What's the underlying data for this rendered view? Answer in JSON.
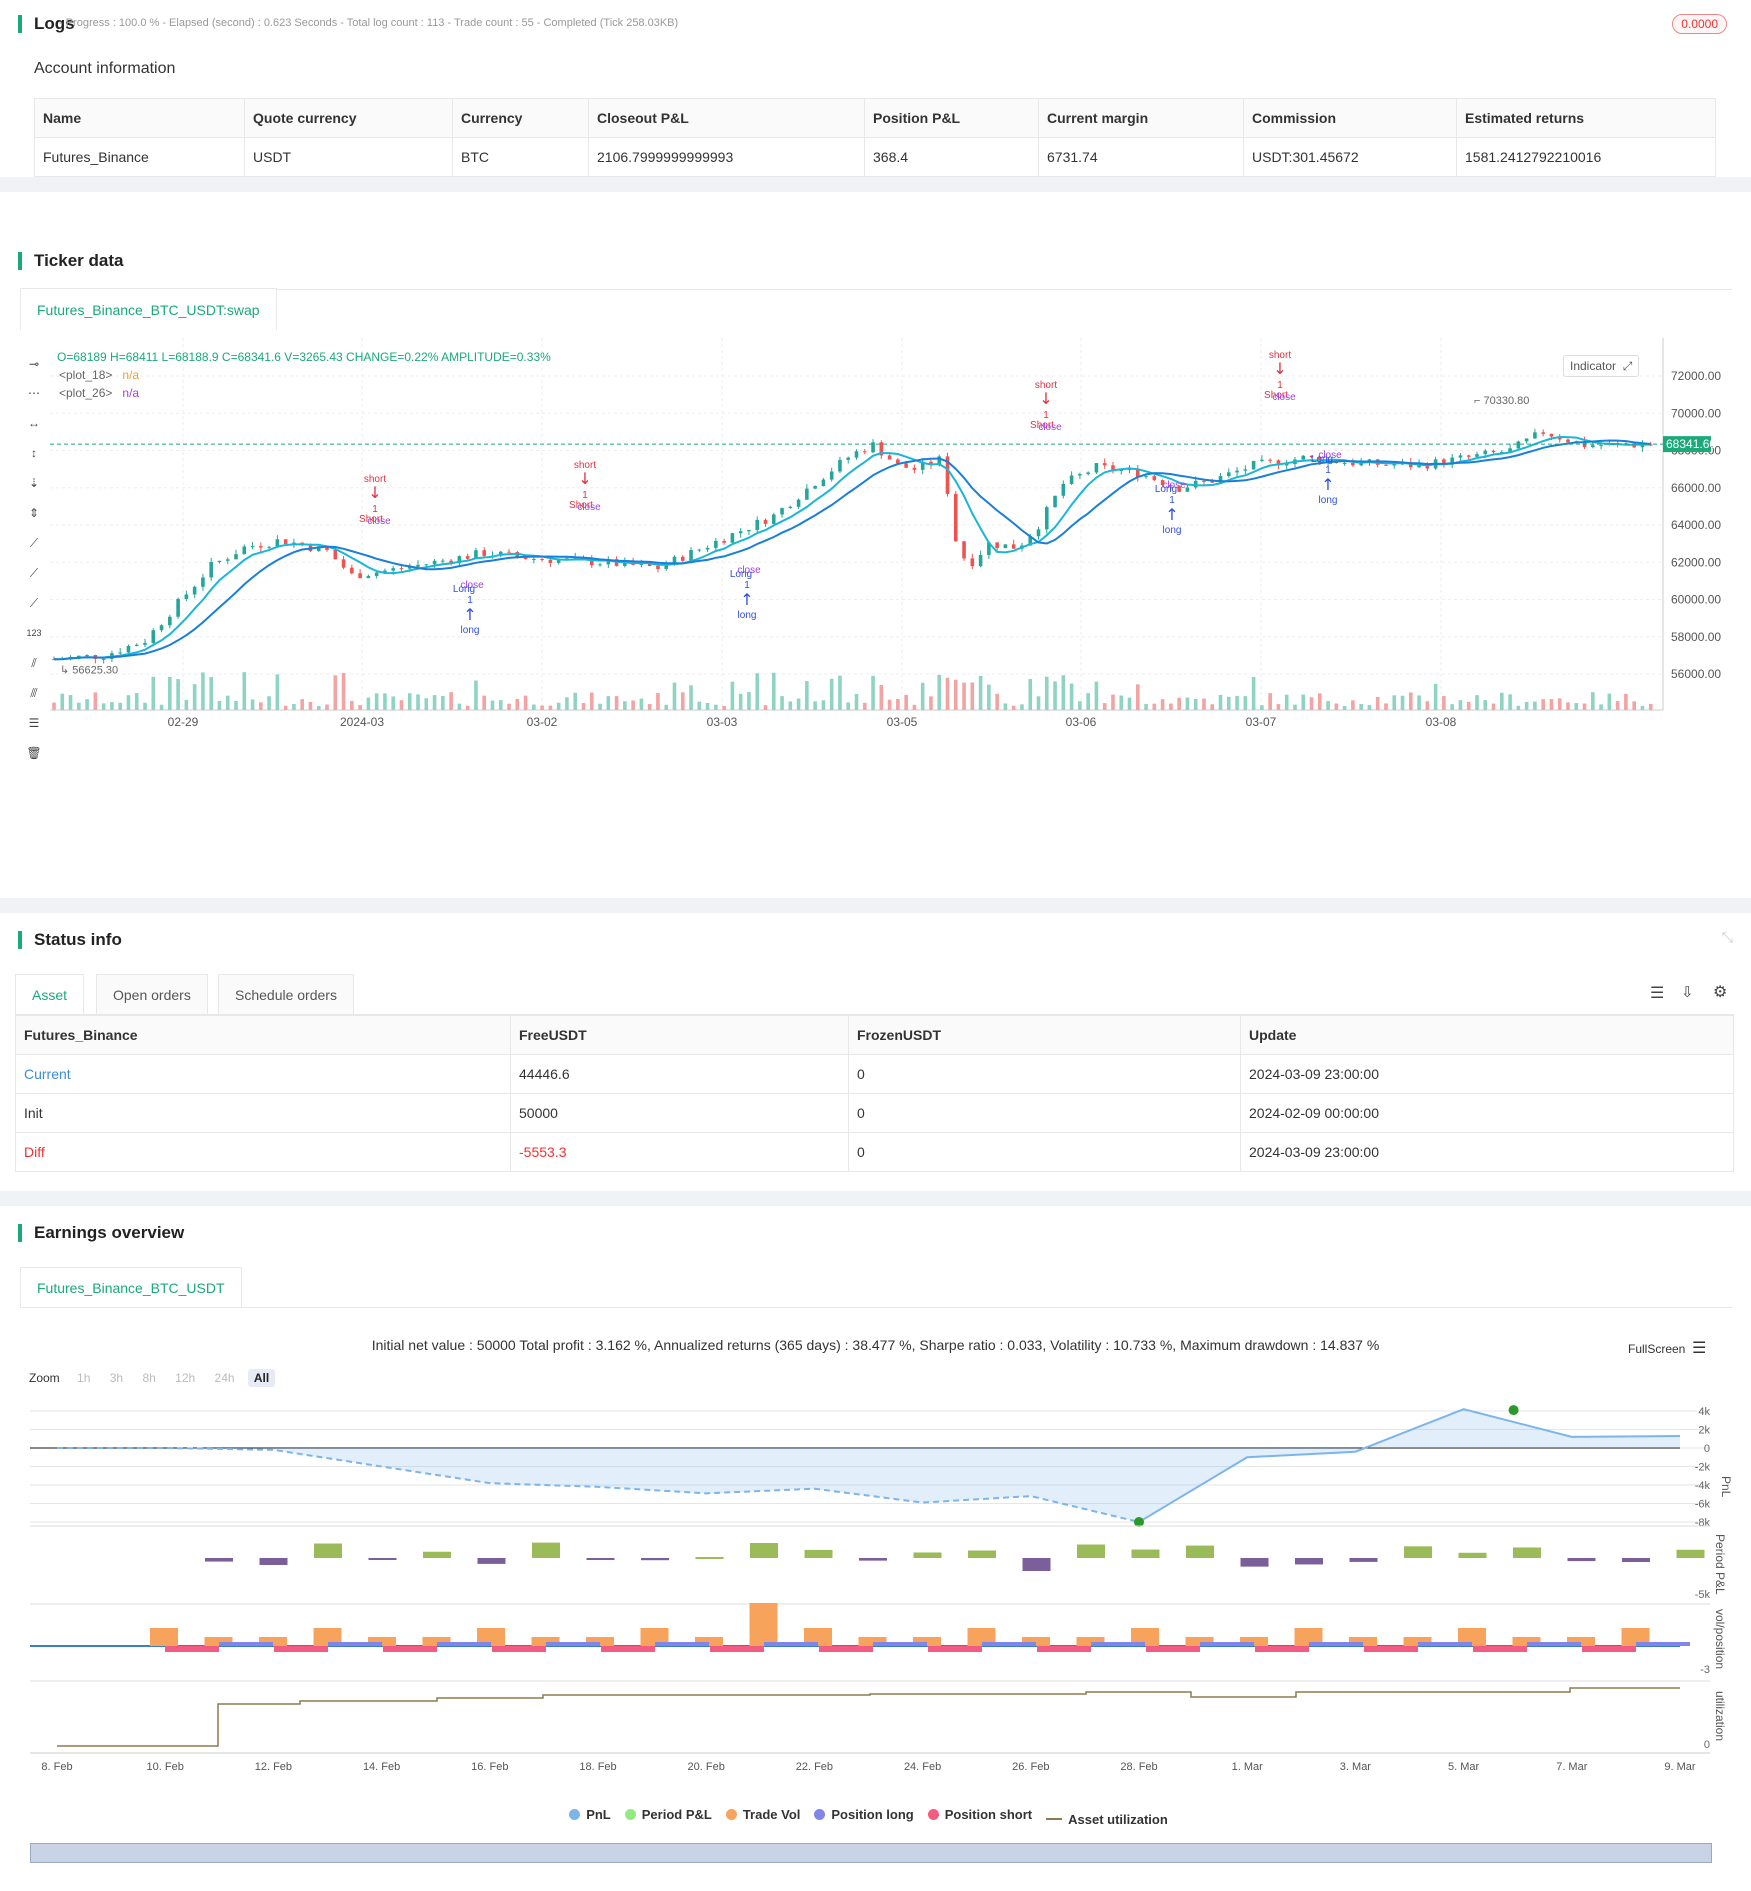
{
  "logs": {
    "title": "Logs",
    "summary": "- Progress : 100.0 % - Elapsed (second) : 0.623 Seconds - Total log count : 113 - Trade count : 55 - Completed (Tick 258.03KB)",
    "badge": "0.0000"
  },
  "account": {
    "title": "Account information",
    "headers": [
      "Name",
      "Quote currency",
      "Currency",
      "Closeout P&L",
      "Position P&L",
      "Current margin",
      "Commission",
      "Estimated returns"
    ],
    "row": [
      "Futures_Binance",
      "USDT",
      "BTC",
      "2106.7999999999993",
      "368.4",
      "6731.74",
      "USDT:301.45672",
      "1581.2412792210016"
    ]
  },
  "ticker": {
    "title": "Ticker data",
    "tab": "Futures_Binance_BTC_USDT:swap",
    "ohlc": "O=68189 H=68411 L=68188.9 C=68341.6 V=3265.43 CHANGE=0.22% AMPLITUDE=0.33%",
    "plot18": "<plot_18>",
    "plot26": "<plot_26>",
    "na": "n/a",
    "indicator_btn": "Indicator",
    "last_price": "68341.60",
    "high_label": "70330.80",
    "low_label": "56625.30",
    "y_ticks": [
      "72000.00",
      "70000.00",
      "68000.00",
      "66000.00",
      "64000.00",
      "62000.00",
      "60000.00",
      "58000.00",
      "56000.00"
    ],
    "x_ticks": [
      "02-29",
      "2024-03",
      "03-02",
      "03-03",
      "03-05",
      "03-06",
      "03-07",
      "03-08"
    ],
    "signals": {
      "short": "short",
      "short_entry": "Short",
      "close": "close",
      "long": "long",
      "long_entry": "Long",
      "qty": "1"
    }
  },
  "status": {
    "title": "Status info",
    "tabs": [
      "Asset",
      "Open orders",
      "Schedule orders"
    ],
    "headers": [
      "Futures_Binance",
      "FreeUSDT",
      "FrozenUSDT",
      "Update"
    ],
    "rows": [
      [
        "Current",
        "44446.6",
        "0",
        "2024-03-09 23:00:00"
      ],
      [
        "Init",
        "50000",
        "0",
        "2024-02-09 00:00:00"
      ],
      [
        "Diff",
        "-5553.3",
        "0",
        "2024-03-09 23:00:00"
      ]
    ]
  },
  "earnings": {
    "title": "Earnings overview",
    "tab": "Futures_Binance_BTC_USDT",
    "summary": "Initial net value : 50000 Total profit : 3.162 %, Annualized returns (365 days) : 38.477 %, Sharpe ratio : 0.033, Volatility : 10.733 %, Maximum drawdown : 14.837 %",
    "fullscreen": "FullScreen",
    "zoom_label": "Zoom",
    "zoom_opts": [
      "1h",
      "3h",
      "8h",
      "12h",
      "24h",
      "All"
    ],
    "pnl_ticks": [
      "4k",
      "2k",
      "0",
      "-2k",
      "-4k",
      "-6k",
      "-8k"
    ],
    "axis_titles": [
      "PnL",
      "Period P&L",
      "vol/position",
      "utilization"
    ],
    "period_tick": "-5k",
    "vol_tick": "-3",
    "util_tick": "0",
    "x_ticks": [
      "8. Feb",
      "10. Feb",
      "12. Feb",
      "14. Feb",
      "16. Feb",
      "18. Feb",
      "20. Feb",
      "22. Feb",
      "24. Feb",
      "26. Feb",
      "28. Feb",
      "1. Mar",
      "3. Mar",
      "5. Mar",
      "7. Mar",
      "9. Mar"
    ],
    "legend": [
      {
        "name": "PnL",
        "color": "#7cb5ec"
      },
      {
        "name": "Period P&L",
        "color": "#90ed7d"
      },
      {
        "name": "Trade Vol",
        "color": "#f7a35c"
      },
      {
        "name": "Position long",
        "color": "#8085e9"
      },
      {
        "name": "Position short",
        "color": "#f15c80"
      },
      {
        "name": "Asset utilization",
        "color": "#8d7b4e"
      }
    ]
  },
  "chart_data": {
    "type": "line",
    "title": "",
    "x": [
      "8. Feb",
      "10. Feb",
      "12. Feb",
      "14. Feb",
      "16. Feb",
      "18. Feb",
      "20. Feb",
      "22. Feb",
      "24. Feb",
      "26. Feb",
      "28. Feb",
      "1. Mar",
      "3. Mar",
      "5. Mar",
      "7. Mar",
      "9. Mar"
    ],
    "series": [
      {
        "name": "PnL",
        "values": [
          0,
          0,
          -200,
          -2000,
          -3800,
          -4200,
          -4900,
          -4400,
          -5900,
          -5200,
          -8000,
          -1000,
          -400,
          4200,
          1200,
          1300
        ]
      }
    ],
    "ylim": [
      -8000,
      4000
    ]
  }
}
